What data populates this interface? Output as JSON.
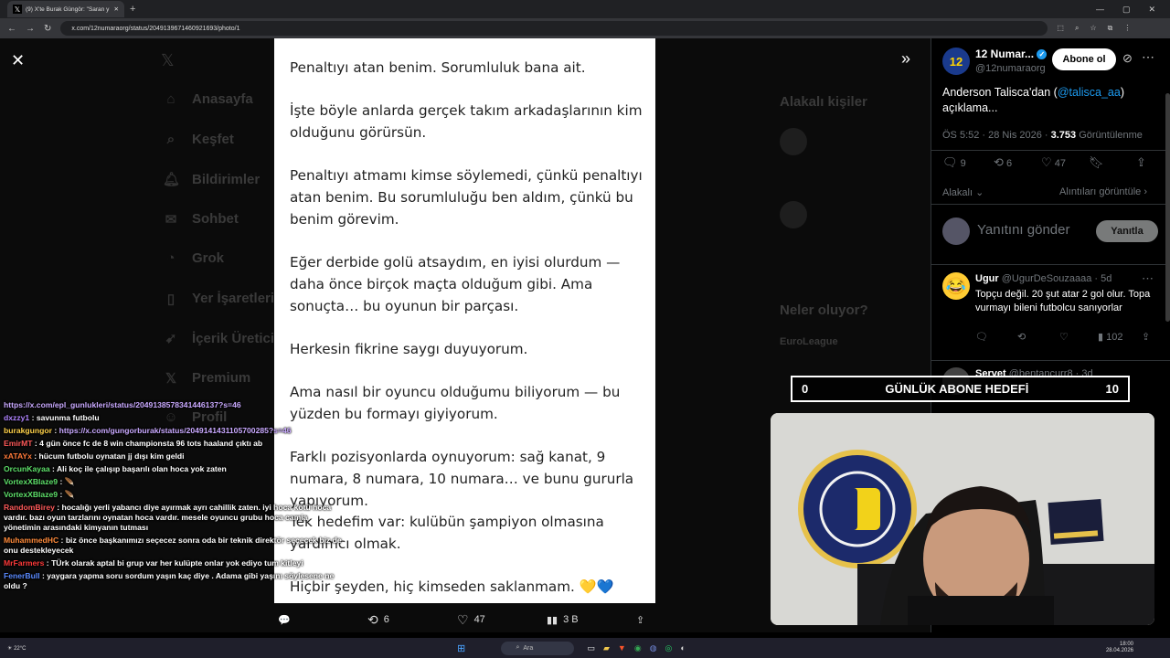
{
  "browser": {
    "tab_title": "(9) X'te Burak Güngör: \"Saran y",
    "url": "x.com/12numaraorg/status/2049139671460921693/photo/1"
  },
  "background_nav": [
    {
      "label": "Anasayfa",
      "icon": "home-icon"
    },
    {
      "label": "Keşfet",
      "icon": "search-icon"
    },
    {
      "label": "Bildirimler",
      "icon": "bell-icon"
    },
    {
      "label": "Sohbet",
      "icon": "chat-icon"
    },
    {
      "label": "Grok",
      "icon": "grok-icon"
    },
    {
      "label": "Yer İşaretleri",
      "icon": "bookmark-icon"
    },
    {
      "label": "İçerik Üretici",
      "icon": "rocket-icon"
    },
    {
      "label": "Premium",
      "icon": "x-icon"
    },
    {
      "label": "Profil",
      "icon": "user-icon"
    }
  ],
  "background_right": {
    "relevant_people": "Alakalı kişiler",
    "whats_happening": "Neler oluyor?",
    "euroleague": "EuroLeague"
  },
  "photo": {
    "paragraphs": [
      "Penaltıyı atan benim. Sorumluluk bana ait.",
      "İşte böyle anlarda gerçek takım arkadaşlarının kim olduğunu görürsün.",
      "Penaltıyı atmamı kimse söylemedi, çünkü penaltıyı atan benim. Bu sorumluluğu ben aldım, çünkü bu benim görevim.",
      "Eğer derbide golü atsaydım, en iyisi olurdum — daha önce birçok maçta olduğum gibi. Ama sonuçta… bu oyunun bir parçası.",
      "Herkesin fikrine saygı duyuyorum.",
      "Ama nasıl bir oyuncu olduğumu biliyorum — bu yüzden bu formayı giyiyorum.",
      "Farklı pozisyonlarda oynuyorum: sağ kanat, 9 numara, 8 numara, 10 numara… ve bunu gururla yapıyorum.",
      "Tek hedefim var: kulübün şampiyon olmasına yardımcı olmak.",
      "Hiçbir şeyden, hiç kimseden saklanmam. 💛💙"
    ]
  },
  "photo_actions": {
    "replies": "",
    "retweets": "6",
    "likes": "47",
    "views": "3 B"
  },
  "tweet": {
    "author_name": "12 Numar...",
    "handle": "@12numaraorg",
    "avatar_text": "12",
    "follow_label": "Abone ol",
    "text_prefix": "Anderson Talisca'dan (",
    "mention": "@talisca_aa",
    "text_suffix": ") açıklama...",
    "time": "ÖS 5:52 · 28 Nis 2026 · ",
    "views_count": "3.753",
    "views_label": "Görüntülenme",
    "replies": "9",
    "retweets": "6",
    "likes": "47",
    "sort_label": "Alakalı",
    "quotes_label": "Alıntıları görüntüle",
    "reply_placeholder": "Yanıtını gönder",
    "reply_button": "Yanıtla"
  },
  "reply": {
    "name": "Ugur",
    "handle": "@UgurDeSouzaaaa · 5d",
    "text": "Topçu değil. 20 şut atar 2 gol olur. Topa vurmayı bileni futbolcu sanıyorlar",
    "views": "102"
  },
  "reply2": {
    "name": "Servet",
    "handle": "@bentancurr8 · 3d"
  },
  "goal": {
    "current": "0",
    "label": "GÜNLÜK ABONE HEDEFİ",
    "target": "10"
  },
  "chat": [
    {
      "user": "",
      "text": "https://x.com/epl_gunlukleri/status/2049138578341446137?s=46",
      "color": "#c9a9ff",
      "isLink": true
    },
    {
      "user": "dxzzy1",
      "text": "savunma futbolu",
      "color": "#b084ff"
    },
    {
      "user": "burakgungor",
      "text": "https://x.com/gungorburak/status/2049141431105700285?s=46",
      "color": "#ffd24a",
      "isLink": true
    },
    {
      "user": "EmirMT",
      "text": "4 gün önce fc de 8 win championsta 96 tots haaland çıktı ab",
      "color": "#ff5a5a"
    },
    {
      "user": "xATAYx",
      "text": "hücum futbolu oynatan jj dışı kim geldi",
      "color": "#ff7a3a"
    },
    {
      "user": "OrcunKayaa",
      "text": "Ali koç ile çalışıp başarılı olan hoca yok zaten",
      "color": "#5ee06a"
    },
    {
      "user": "VortexXBlaze9",
      "text": "🪶",
      "color": "#5ee06a"
    },
    {
      "user": "VortexXBlaze9",
      "text": "🪶",
      "color": "#5ee06a"
    },
    {
      "user": "RandomBirey",
      "text": "hocalığı yerli yabancı diye ayırmak ayrı cahillik zaten. iyi hoca kötü hoca vardır. bazı oyun tarzlarını oynatan hoca vardır. mesele oyuncu grubu hoca camia yönetimin arasındaki kimyanın tutması",
      "color": "#ff5a5a"
    },
    {
      "user": "MuhammedHC",
      "text": "biz önce başkanımızı seçecez sonra oda bir teknik direktör seçecek biz de onu destekleyecek",
      "color": "#ff8a3a"
    },
    {
      "user": "MrFarmers",
      "text": "TÜrk olarak aptal bi grup var her kulüpte onlar yok ediyo tum kitleyi",
      "color": "#ff3a3a"
    },
    {
      "user": "FenerBull",
      "text": "yaygara yapma soru sordum yaşın kaç diye . Adama gibi yaşını söylesene ne oldu ?",
      "color": "#5a8aff"
    }
  ],
  "taskbar": {
    "search": "Ara",
    "time": "18:00",
    "date": "28.04.2026",
    "weather": "22°C"
  }
}
